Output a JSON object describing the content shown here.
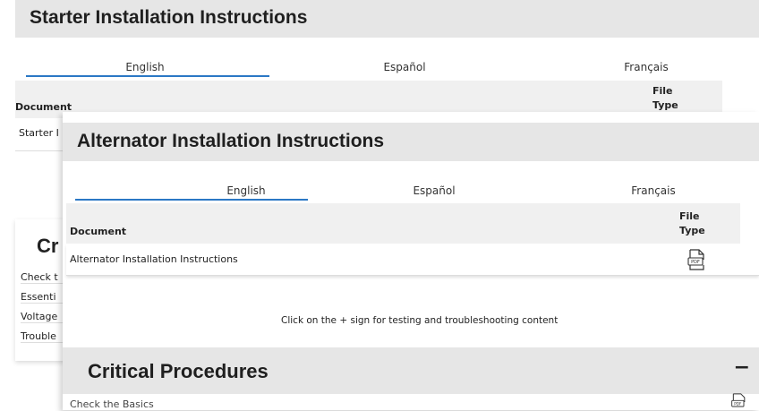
{
  "starter": {
    "title": "Starter Installation Instructions",
    "tabs": [
      "English",
      "Español",
      "Français"
    ],
    "table": {
      "col_document": "Document",
      "col_filetype": "File Type",
      "rows": [
        {
          "document": "Starter I"
        }
      ]
    }
  },
  "background_section": {
    "heading": "Cr",
    "items": [
      "Check t",
      "Essenti",
      "Voltage",
      "Trouble"
    ]
  },
  "alternator": {
    "title": "Alternator Installation Instructions",
    "tabs": [
      "English",
      "Español",
      "Français"
    ],
    "table": {
      "col_document": "Document",
      "col_filetype": "File Type",
      "rows": [
        {
          "document": "Alternator Installation Instructions",
          "filetype": "PDF"
        }
      ]
    },
    "note": "Click on the + sign for testing and troubleshooting content"
  },
  "critical": {
    "title": "Critical Procedures",
    "toggle": "−",
    "first_item": "Check the Basics"
  },
  "colors": {
    "title_bar": "#e6e6e6",
    "tab_underline": "#2b78c5"
  }
}
